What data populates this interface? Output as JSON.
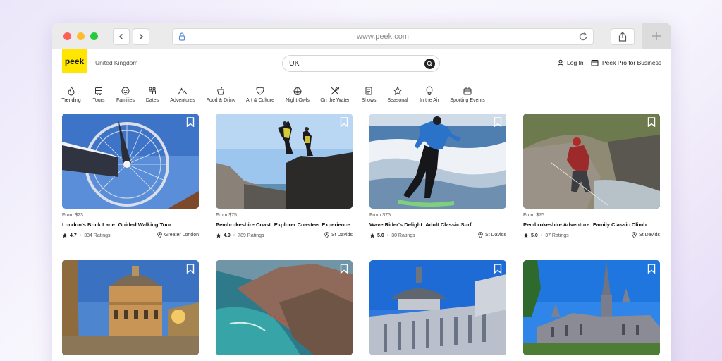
{
  "browser": {
    "url": "www.peek.com"
  },
  "header": {
    "logo_text": "peek",
    "region": "United Kingdom",
    "search_value": "UK",
    "login_label": "Log In",
    "pro_label": "Peek Pro for Business"
  },
  "categories": [
    {
      "label": "Trending",
      "icon": "flame-icon"
    },
    {
      "label": "Tours",
      "icon": "bus-icon"
    },
    {
      "label": "Families",
      "icon": "family-icon"
    },
    {
      "label": "Dates",
      "icon": "couple-icon"
    },
    {
      "label": "Adventures",
      "icon": "mountain-icon"
    },
    {
      "label": "Food & Drink",
      "icon": "drink-icon"
    },
    {
      "label": "Art & Culture",
      "icon": "theater-mask-icon"
    },
    {
      "label": "Night Owls",
      "icon": "disco-ball-icon"
    },
    {
      "label": "On the Water",
      "icon": "paddle-icon"
    },
    {
      "label": "Shows",
      "icon": "ticket-icon"
    },
    {
      "label": "Seasonal",
      "icon": "star-icon"
    },
    {
      "label": "In the Air",
      "icon": "balloon-icon"
    },
    {
      "label": "Sporting Events",
      "icon": "stadium-icon"
    }
  ],
  "listings": [
    {
      "price": "From $23",
      "title": "London's Brick Lane: Guided Walking Tour",
      "rating": "4.7",
      "ratings_count": "334 Ratings",
      "location": "Greater London",
      "image": "london-eye-photo"
    },
    {
      "price": "From $75",
      "title": "Pembrokeshire Coast: Explorer Coasteer Experience",
      "rating": "4.9",
      "ratings_count": "789 Ratings",
      "location": "St Davids",
      "image": "cliff-jumpers-photo"
    },
    {
      "price": "From $75",
      "title": "Wave Rider's Delight: Adult Classic Surf",
      "rating": "5.0",
      "ratings_count": "30 Ratings",
      "location": "St Davids",
      "image": "surfer-photo"
    },
    {
      "price": "From $75",
      "title": "Pembrokeshire Adventure: Family Classic Climb",
      "rating": "5.0",
      "ratings_count": "37 Ratings",
      "location": "St Davids",
      "image": "rock-climber-photo"
    },
    {
      "image": "radcliffe-camera-photo"
    },
    {
      "image": "coastal-rocks-photo"
    },
    {
      "image": "st-pauls-cathedral-photo"
    },
    {
      "image": "salisbury-cathedral-photo"
    }
  ],
  "colors": {
    "brand": "#ffe500",
    "text": "#111111"
  }
}
